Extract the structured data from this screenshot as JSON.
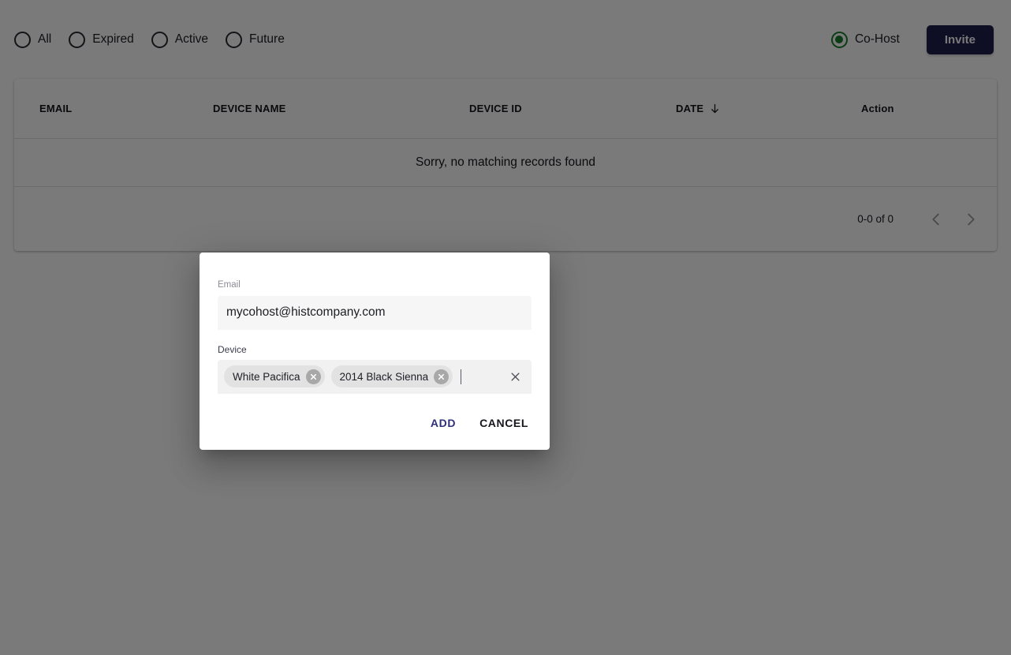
{
  "filters": {
    "options": [
      {
        "label": "All",
        "selected": false
      },
      {
        "label": "Expired",
        "selected": false
      },
      {
        "label": "Active",
        "selected": false
      },
      {
        "label": "Future",
        "selected": false
      }
    ],
    "cohost": {
      "label": "Co-Host",
      "selected": true,
      "color": "#1b7d2f"
    },
    "invite_button": {
      "label": "Invite",
      "color": "#1f1f4b"
    }
  },
  "table": {
    "columns": [
      {
        "key": "email",
        "label": "EMAIL"
      },
      {
        "key": "device_name",
        "label": "DEVICE NAME"
      },
      {
        "key": "device_id",
        "label": "DEVICE ID"
      },
      {
        "key": "date",
        "label": "DATE",
        "sorted": "descending"
      },
      {
        "key": "action",
        "label": "Action"
      }
    ],
    "rows": [],
    "empty_message": "Sorry, no matching records found",
    "pagination": {
      "range_label": "0-0 of 0",
      "prev_enabled": false,
      "next_enabled": false
    }
  },
  "dialog": {
    "email_field": {
      "label": "Email",
      "value": "mycohost@histcompany.com"
    },
    "device_field": {
      "label": "Device",
      "chips": [
        {
          "label": "White Pacifica"
        },
        {
          "label": "2014 Black Sienna"
        }
      ]
    },
    "buttons": {
      "add": "ADD",
      "cancel": "CANCEL"
    }
  }
}
